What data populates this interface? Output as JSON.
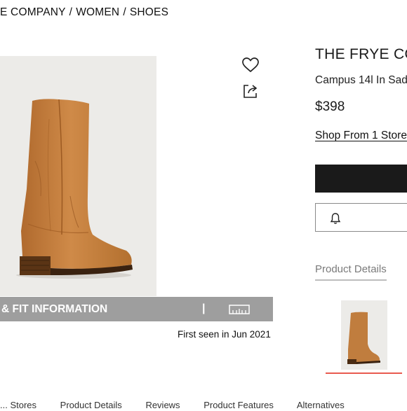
{
  "breadcrumb": {
    "items": [
      "E COMPANY",
      "WOMEN",
      "SHOES"
    ],
    "separator": "/"
  },
  "gallery": {
    "icons": {
      "favorite": "heart-icon",
      "share": "share-icon",
      "ruler": "ruler-icon"
    },
    "fit_label": "& FIT INFORMATION",
    "divider": "|",
    "first_seen": "First seen in Jun 2021"
  },
  "product": {
    "brand": "THE FRYE CO",
    "name": "Campus 14l In Sad",
    "price": "$398",
    "shop_link": "Shop From 1 Store"
  },
  "actions": {
    "buy_button_color": "#1a1a1a",
    "alert_icon": "bell-icon"
  },
  "tabs": {
    "product_details": "Product Details",
    "active_accent": "#e85a4f"
  },
  "bottom_tabs": [
    "... Stores",
    "Product Details",
    "Reviews",
    "Product Features",
    "Alternatives"
  ]
}
